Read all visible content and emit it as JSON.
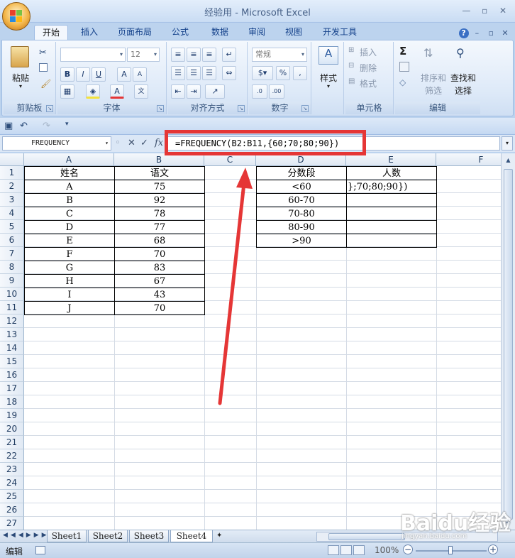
{
  "window": {
    "title": "经验用 - Microsoft Excel"
  },
  "tabs": [
    "开始",
    "插入",
    "页面布局",
    "公式",
    "数据",
    "审阅",
    "视图",
    "开发工具"
  ],
  "ribbon": {
    "clipboard": {
      "paste": "粘贴",
      "label": "剪贴板"
    },
    "font": {
      "font_size": "12",
      "bold": "B",
      "italic": "I",
      "underline": "U",
      "grow": "A",
      "shrink": "A",
      "label": "字体"
    },
    "alignment": {
      "label": "对齐方式"
    },
    "number": {
      "format": "常规",
      "percent": "%",
      "comma": ",",
      "label": "数字"
    },
    "styles": {
      "label": "样式"
    },
    "cells": {
      "insert": "插入",
      "delete": "删除",
      "format": "格式",
      "label": "单元格"
    },
    "editing": {
      "sum": "Σ",
      "sort_filter_1": "排序和",
      "sort_filter_2": "筛选",
      "find_select_1": "查找和",
      "find_select_2": "选择",
      "label": "编辑"
    }
  },
  "formula_bar": {
    "name_box": "FREQUENCY",
    "cancel": "✕",
    "enter": "✓",
    "fx": "fx",
    "formula": "=FREQUENCY(B2:B11,{60;70;80;90})"
  },
  "columns": [
    "A",
    "B",
    "C",
    "D",
    "E",
    "F"
  ],
  "rows": [
    "1",
    "2",
    "3",
    "4",
    "5",
    "6",
    "7",
    "8",
    "9",
    "10",
    "11",
    "12",
    "13",
    "14",
    "15",
    "16",
    "17",
    "18",
    "19",
    "20",
    "21",
    "22",
    "23",
    "24",
    "25",
    "26",
    "27"
  ],
  "sheet": {
    "name_header": "姓名",
    "score_header": "语文",
    "students": [
      {
        "name": "A",
        "score": "75"
      },
      {
        "name": "B",
        "score": "92"
      },
      {
        "name": "C",
        "score": "78"
      },
      {
        "name": "D",
        "score": "77"
      },
      {
        "name": "E",
        "score": "68"
      },
      {
        "name": "F",
        "score": "70"
      },
      {
        "name": "G",
        "score": "83"
      },
      {
        "name": "H",
        "score": "67"
      },
      {
        "name": "I",
        "score": "43"
      },
      {
        "name": "J",
        "score": "70"
      }
    ],
    "band_header": "分数段",
    "count_header": "人数",
    "bands": [
      "<60",
      "60-70",
      "70-80",
      "80-90",
      ">90"
    ],
    "count_edit_text": "};70;80;90})"
  },
  "sheet_tabs": [
    "Sheet1",
    "Sheet2",
    "Sheet3",
    "Sheet4"
  ],
  "status": {
    "mode": "编辑",
    "zoom": "100%"
  },
  "watermark": {
    "brand": "Baidu经验",
    "url": "jingyan.baidu.com"
  },
  "colors": {
    "annotation_red": "#e53636",
    "ribbon_blue": "#15428b"
  }
}
